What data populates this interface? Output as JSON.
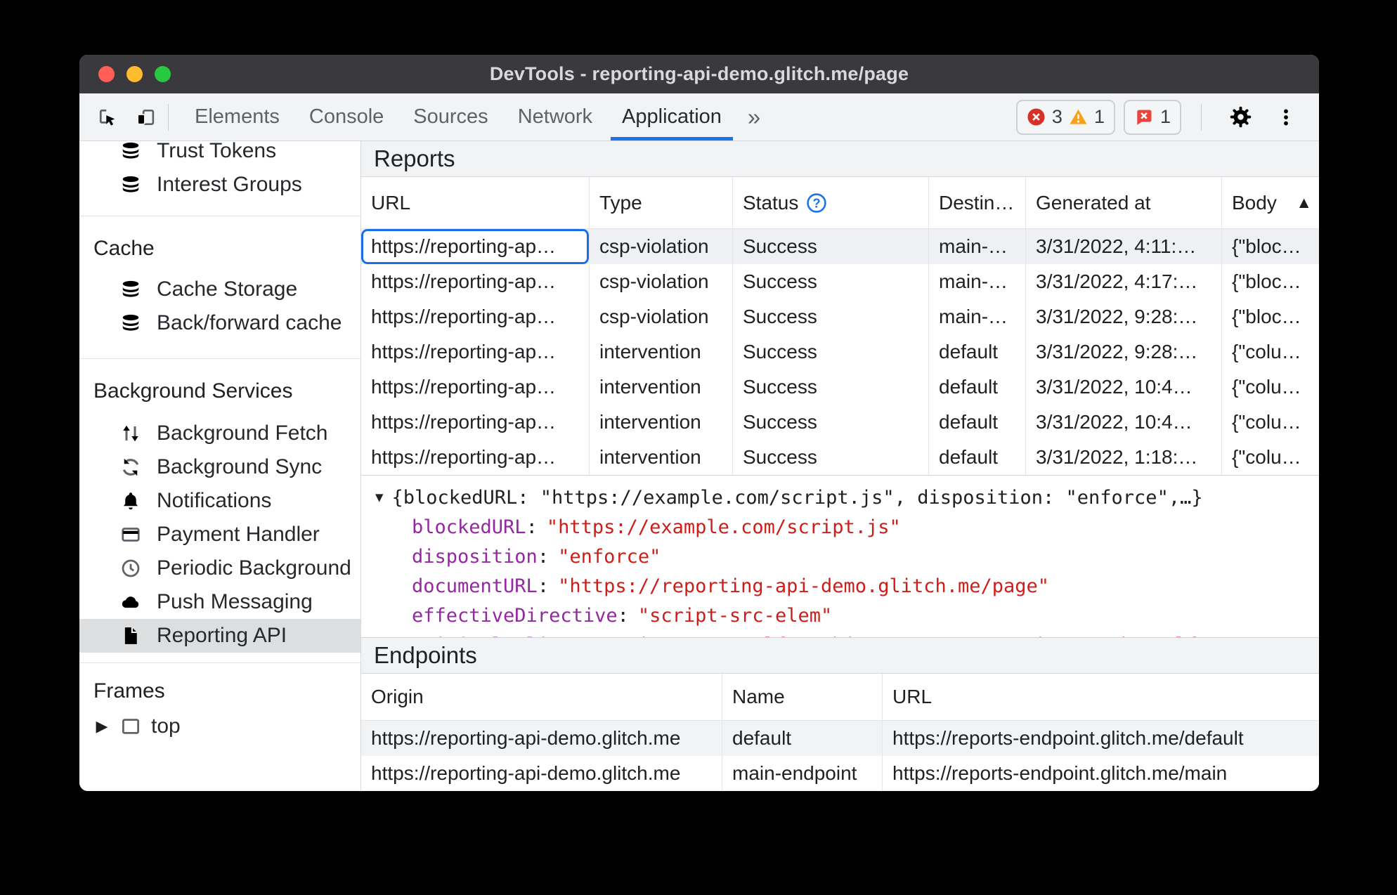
{
  "window": {
    "title": "DevTools - reporting-api-demo.glitch.me/page"
  },
  "icons": {
    "more_tabs": "»",
    "sort_ascending": "▲",
    "expand": "▼",
    "collapse": "▶",
    "help": "?"
  },
  "colors": {
    "accent_blue": "#1a73e8",
    "error_red": "#d93025",
    "warning_orange": "#f5a31d",
    "issue_red": "#e8463c",
    "key_purple": "#9328a0",
    "value_red": "#cd1e19"
  },
  "toolbar": {
    "tabs": [
      "Elements",
      "Console",
      "Sources",
      "Network",
      "Application"
    ],
    "selected_tab": "Application",
    "error_count": "3",
    "warning_count": "1",
    "issue_count": "1"
  },
  "sidebar": {
    "top_items": [
      {
        "icon": "database-icon",
        "label": "Trust Tokens"
      },
      {
        "icon": "database-icon",
        "label": "Interest Groups"
      }
    ],
    "cache_section": {
      "title": "Cache",
      "items": [
        {
          "icon": "database-icon",
          "label": "Cache Storage"
        },
        {
          "icon": "database-icon",
          "label": "Back/forward cache"
        }
      ]
    },
    "bg_section": {
      "title": "Background Services",
      "items": [
        {
          "icon": "background-fetch-icon",
          "label": "Background Fetch"
        },
        {
          "icon": "background-sync-icon",
          "label": "Background Sync"
        },
        {
          "icon": "notifications-icon",
          "label": "Notifications"
        },
        {
          "icon": "payment-handler-icon",
          "label": "Payment Handler"
        },
        {
          "icon": "periodic-background-icon",
          "label": "Periodic Background"
        },
        {
          "icon": "push-messaging-icon",
          "label": "Push Messaging"
        },
        {
          "icon": "reporting-api-icon",
          "label": "Reporting API",
          "selected": true
        }
      ]
    },
    "frames_section": {
      "title": "Frames",
      "items": [
        {
          "icon": "frame-icon",
          "label": "top"
        }
      ]
    }
  },
  "reports": {
    "title": "Reports",
    "columns": {
      "url": "URL",
      "type": "Type",
      "status": "Status",
      "destination": "Destin…",
      "generated": "Generated at",
      "body": "Body"
    },
    "rows": [
      {
        "url": "https://reporting-ap…",
        "type": "csp-violation",
        "status": "Success",
        "destination": "main-…",
        "generated": "3/31/2022, 4:11:…",
        "body": "{\"bloc…",
        "selected": true
      },
      {
        "url": "https://reporting-ap…",
        "type": "csp-violation",
        "status": "Success",
        "destination": "main-…",
        "generated": "3/31/2022, 4:17:…",
        "body": "{\"bloc…",
        "selected": false
      },
      {
        "url": "https://reporting-ap…",
        "type": "csp-violation",
        "status": "Success",
        "destination": "main-…",
        "generated": "3/31/2022, 9:28:…",
        "body": "{\"bloc…",
        "selected": false
      },
      {
        "url": "https://reporting-ap…",
        "type": "intervention",
        "status": "Success",
        "destination": "default",
        "generated": "3/31/2022, 9:28:…",
        "body": "{\"colu…",
        "selected": false
      },
      {
        "url": "https://reporting-ap…",
        "type": "intervention",
        "status": "Success",
        "destination": "default",
        "generated": "3/31/2022, 10:4…",
        "body": "{\"colu…",
        "selected": false
      },
      {
        "url": "https://reporting-ap…",
        "type": "intervention",
        "status": "Success",
        "destination": "default",
        "generated": "3/31/2022, 10:4…",
        "body": "{\"colu…",
        "selected": false
      },
      {
        "url": "https://reporting-ap…",
        "type": "intervention",
        "status": "Success",
        "destination": "default",
        "generated": "3/31/2022, 1:18:…",
        "body": "{\"colu…",
        "selected": false
      }
    ]
  },
  "report_detail": {
    "preview": "{blockedURL: \"https://example.com/script.js\", disposition: \"enforce\",…}",
    "properties": [
      {
        "key": "blockedURL",
        "value": "\"https://example.com/script.js\""
      },
      {
        "key": "disposition",
        "value": "\"enforce\""
      },
      {
        "key": "documentURL",
        "value": "\"https://reporting-api-demo.glitch.me/page\""
      },
      {
        "key": "effectiveDirective",
        "value": "\"script-src-elem\""
      },
      {
        "key": "originalPolicy",
        "value": "\"script-src 'self'; object-src 'none'; base-uri 'self'; report-to main-endpoint\""
      }
    ]
  },
  "endpoints": {
    "title": "Endpoints",
    "columns": {
      "origin": "Origin",
      "name": "Name",
      "url": "URL"
    },
    "rows": [
      {
        "origin": "https://reporting-api-demo.glitch.me",
        "name": "default",
        "url": "https://reports-endpoint.glitch.me/default"
      },
      {
        "origin": "https://reporting-api-demo.glitch.me",
        "name": "main-endpoint",
        "url": "https://reports-endpoint.glitch.me/main"
      }
    ]
  }
}
